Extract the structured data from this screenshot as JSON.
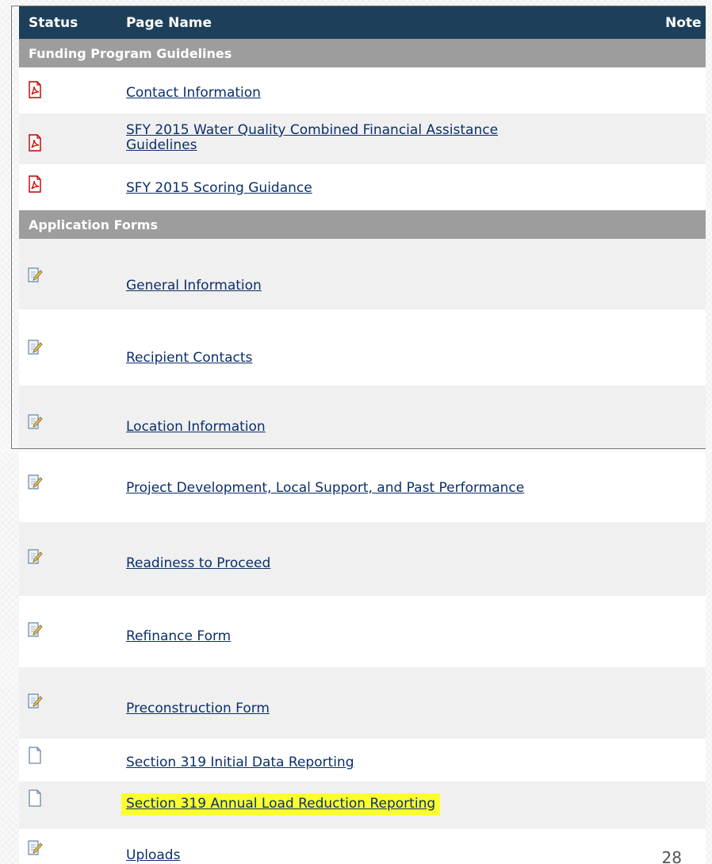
{
  "table": {
    "headers": {
      "status": "Status",
      "page_name": "Page Name",
      "notes": "Note"
    },
    "sections": [
      {
        "title": "Funding Program Guidelines",
        "rows": [
          {
            "icon": "pdf-icon",
            "label": "Contact Information"
          },
          {
            "icon": "pdf-icon",
            "label_line1": "SFY 2015 Water Quality Combined Financial Assistance",
            "label_line2": "Guidelines"
          },
          {
            "icon": "pdf-icon",
            "label": "SFY 2015 Scoring Guidance"
          }
        ]
      },
      {
        "title": "Application Forms",
        "rows": [
          {
            "icon": "edit-form-icon",
            "label": "General Information"
          },
          {
            "icon": "edit-form-icon",
            "label": "Recipient Contacts"
          },
          {
            "icon": "edit-form-icon",
            "label": "Location Information"
          },
          {
            "icon": "edit-form-icon",
            "label": "Project Development, Local Support, and Past Performance"
          },
          {
            "icon": "edit-form-icon",
            "label": "Readiness to Proceed"
          },
          {
            "icon": "edit-form-icon",
            "label": "Refinance Form"
          },
          {
            "icon": "edit-form-icon",
            "label": "Preconstruction Form"
          },
          {
            "icon": "blank-document-icon",
            "label": "Section 319 Initial Data Reporting"
          },
          {
            "icon": "blank-document-icon",
            "label": "Section 319 Annual Load Reduction Reporting",
            "highlighted": true
          },
          {
            "icon": "edit-form-icon",
            "label": "Uploads"
          }
        ]
      }
    ]
  },
  "page_number": "28",
  "colors": {
    "header_bg": "#1d3f5a",
    "section_bg": "#9d9d9d",
    "link": "#0b2f6b",
    "highlight": "#fbff2c",
    "alt_row": "#f0f0f0"
  }
}
